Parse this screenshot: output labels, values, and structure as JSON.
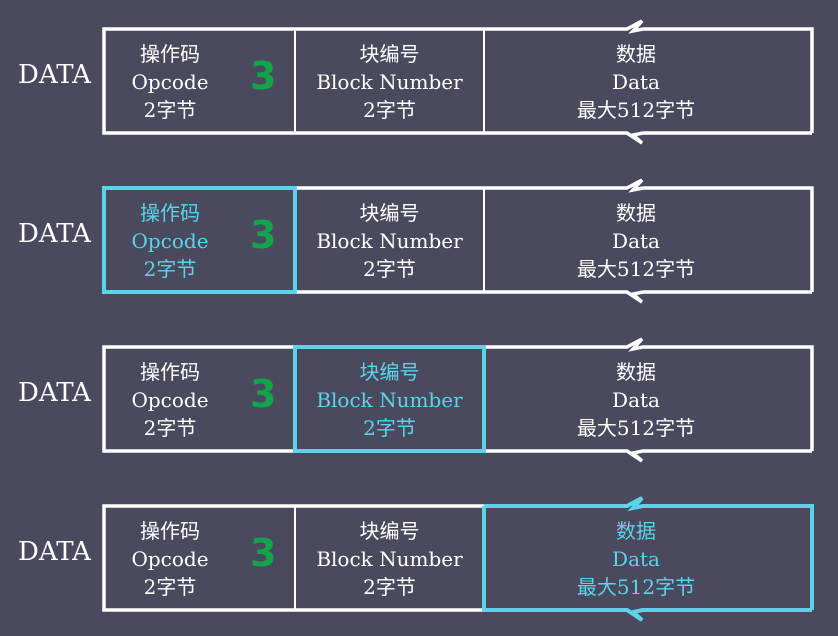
{
  "colors": {
    "background": "#4a4a5e",
    "frame": "#ffffff",
    "highlight": "#5bd3ea",
    "opcode_number": "#13a34a"
  },
  "rows": [
    {
      "label": "DATA",
      "highlight": "none",
      "opcode": {
        "name": "操作码",
        "en": "Opcode",
        "size": "2字节",
        "value": "3"
      },
      "block": {
        "name": "块编号",
        "en": "Block Number",
        "size": "2字节"
      },
      "data": {
        "name": "数据",
        "en": "Data",
        "size": "最大512字节"
      }
    },
    {
      "label": "DATA",
      "highlight": "opcode",
      "opcode": {
        "name": "操作码",
        "en": "Opcode",
        "size": "2字节",
        "value": "3"
      },
      "block": {
        "name": "块编号",
        "en": "Block Number",
        "size": "2字节"
      },
      "data": {
        "name": "数据",
        "en": "Data",
        "size": "最大512字节"
      }
    },
    {
      "label": "DATA",
      "highlight": "block",
      "opcode": {
        "name": "操作码",
        "en": "Opcode",
        "size": "2字节",
        "value": "3"
      },
      "block": {
        "name": "块编号",
        "en": "Block Number",
        "size": "2字节"
      },
      "data": {
        "name": "数据",
        "en": "Data",
        "size": "最大512字节"
      }
    },
    {
      "label": "DATA",
      "highlight": "data",
      "opcode": {
        "name": "操作码",
        "en": "Opcode",
        "size": "2字节",
        "value": "3"
      },
      "block": {
        "name": "块编号",
        "en": "Block Number",
        "size": "2字节"
      },
      "data": {
        "name": "数据",
        "en": "Data",
        "size": "最大512字节"
      }
    }
  ]
}
